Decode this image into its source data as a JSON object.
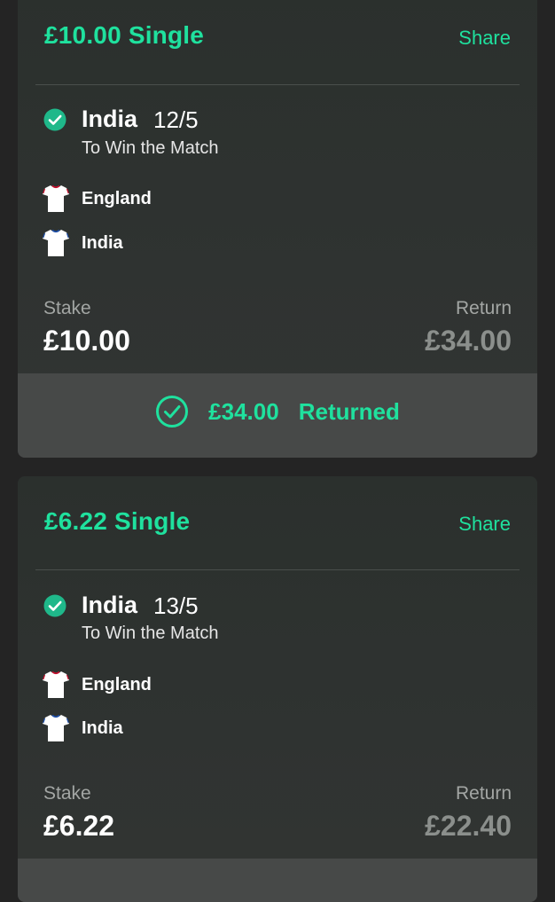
{
  "colors": {
    "accent": "#1fe19e",
    "card": "#2f3331",
    "background": "#242424",
    "returned_bar": "#474948"
  },
  "bets": [
    {
      "title": "£10.00 Single",
      "share_label": "Share",
      "selection": "India",
      "odds": "12/5",
      "market": "To Win the Match",
      "teams": [
        {
          "name": "England",
          "icon": "england-shirt-icon"
        },
        {
          "name": "India",
          "icon": "india-shirt-icon"
        }
      ],
      "stake_label": "Stake",
      "stake": "£10.00",
      "return_label": "Return",
      "return": "£34.00",
      "returned_amount": "£34.00",
      "returned_label": "Returned"
    },
    {
      "title": "£6.22 Single",
      "share_label": "Share",
      "selection": "India",
      "odds": "13/5",
      "market": "To Win the Match",
      "teams": [
        {
          "name": "England",
          "icon": "england-shirt-icon"
        },
        {
          "name": "India",
          "icon": "india-shirt-icon"
        }
      ],
      "stake_label": "Stake",
      "stake": "£6.22",
      "return_label": "Return",
      "return": "£22.40"
    }
  ]
}
